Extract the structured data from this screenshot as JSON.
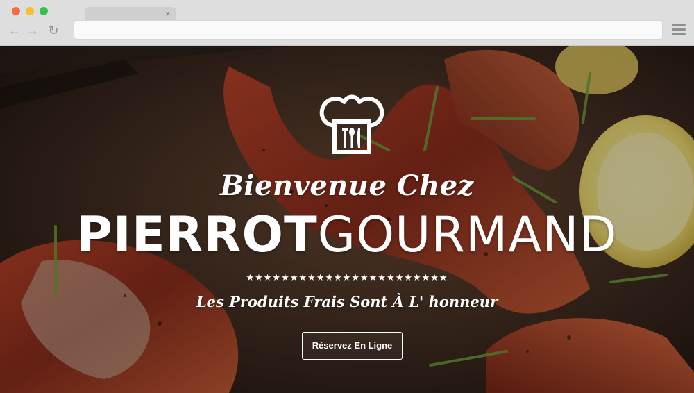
{
  "browser": {
    "tab_close": "×",
    "nav": {
      "back": "←",
      "forward": "→",
      "reload": "↻"
    }
  },
  "hero": {
    "welcome": "Bienvenue Chez",
    "brand_bold": "PIERROT",
    "brand_light": "GOURMAND",
    "divider": "★★★★★★★★★★★★★★★★★★★★★★★",
    "tagline": "Les Produits Frais Sont À L' honneur",
    "cta_label": "Réservez En Ligne"
  },
  "colors": {
    "chrome_bg": "#dedede",
    "close_dot": "#f56a4b",
    "minimize_dot": "#f4c02c",
    "maximize_dot": "#35c24c",
    "hero_text": "#ffffff"
  },
  "icons": [
    "chef-hat-icon",
    "hamburger-menu-icon",
    "back-arrow-icon",
    "forward-arrow-icon",
    "reload-icon",
    "close-icon"
  ]
}
